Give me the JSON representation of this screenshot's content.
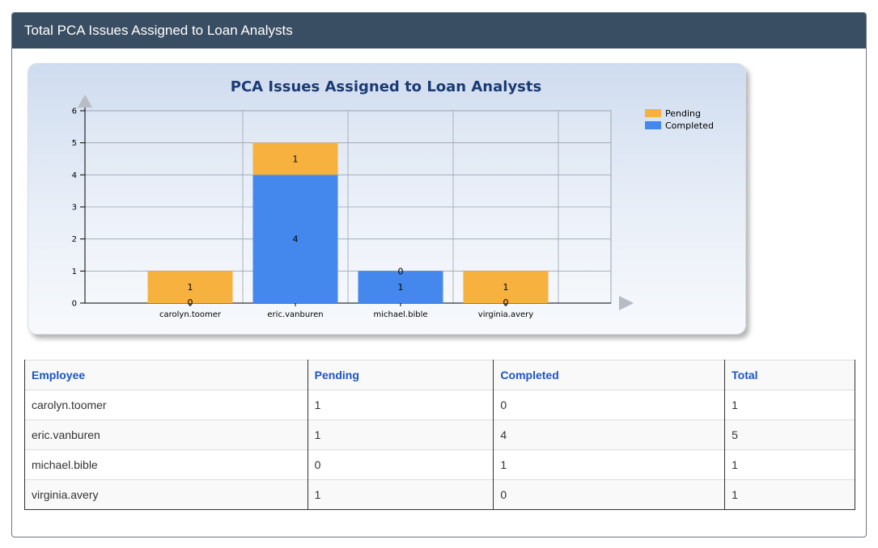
{
  "panel": {
    "title": "Total PCA Issues Assigned to Loan Analysts"
  },
  "chart_data": {
    "type": "bar",
    "stacked": true,
    "title": "PCA Issues Assigned to Loan Analysts",
    "categories": [
      "carolyn.toomer",
      "eric.vanburen",
      "michael.bible",
      "virginia.avery"
    ],
    "series": [
      {
        "name": "Completed",
        "values": [
          0,
          4,
          1,
          0
        ],
        "color": "#4488ee"
      },
      {
        "name": "Pending",
        "values": [
          1,
          1,
          0,
          1
        ],
        "color": "#f7b13e"
      }
    ],
    "ylim": [
      0,
      6
    ],
    "yticks": [
      0,
      1,
      2,
      3,
      4,
      5,
      6
    ],
    "grid": true,
    "legend": "top-right"
  },
  "table": {
    "headers": {
      "employee": "Employee",
      "pending": "Pending",
      "completed": "Completed",
      "total": "Total"
    },
    "rows": [
      {
        "employee": "carolyn.toomer",
        "pending": "1",
        "completed": "0",
        "total": "1"
      },
      {
        "employee": "eric.vanburen",
        "pending": "1",
        "completed": "4",
        "total": "5"
      },
      {
        "employee": "michael.bible",
        "pending": "0",
        "completed": "1",
        "total": "1"
      },
      {
        "employee": "virginia.avery",
        "pending": "1",
        "completed": "0",
        "total": "1"
      }
    ]
  }
}
